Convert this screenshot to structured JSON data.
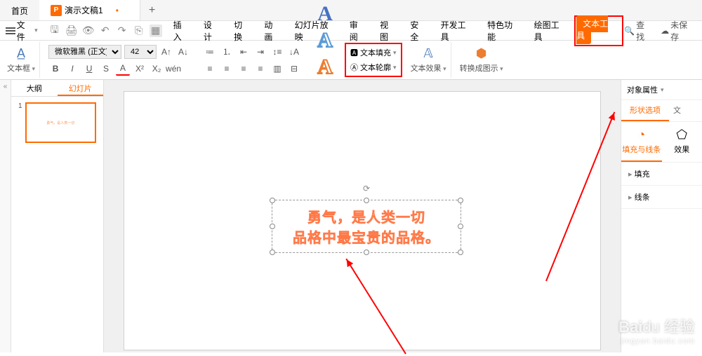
{
  "tabs": {
    "home": "首页",
    "doc": "演示文稿1"
  },
  "menu": {
    "file": "文件",
    "items": [
      "插入",
      "设计",
      "切换",
      "动画",
      "幻灯片放映",
      "审阅",
      "视图",
      "安全",
      "开发工具",
      "特色功能",
      "绘图工具",
      "文本工具"
    ],
    "search": "查找",
    "unsaved": "未保存"
  },
  "ribbon": {
    "textbox": "文本框",
    "font_name": "微软雅黑 (正文)",
    "font_size": "42",
    "text_fill": "文本填充",
    "text_outline": "文本轮廓",
    "text_effect": "文本效果",
    "convert_smart": "转换成图示"
  },
  "panel": {
    "outline": "大纲",
    "slides": "幻灯片",
    "thumb_text": "勇气，是人类一切"
  },
  "canvas": {
    "line1": "勇气，是人类一切",
    "line2": "品格中最宝贵的品格。"
  },
  "props": {
    "title": "对象属性",
    "tab_shape": "形状选项",
    "tab_text": "文",
    "sub_fill": "填充与线条",
    "sub_effect": "效果",
    "sec_fill": "填充",
    "sec_line": "线条"
  },
  "watermark": {
    "main": "Baidu 经验",
    "sub": "jingyan.baidu.com"
  }
}
